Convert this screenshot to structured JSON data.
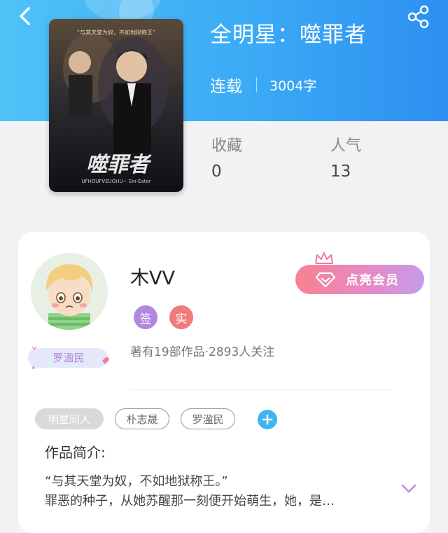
{
  "book": {
    "title": "全明星：噬罪者",
    "status": "连载",
    "word_count": "3004字",
    "cover_title": "噬罪者",
    "cover_tagline": "“与其天堂为奴，不如地狱称王”",
    "cover_subtitle": "UFHOUFVEUGHU~ Sin-Eater"
  },
  "stats": {
    "favorites_label": "收藏",
    "favorites_value": "0",
    "popularity_label": "人气",
    "popularity_value": "13"
  },
  "author": {
    "name": "木VV",
    "badge_sign": "签",
    "badge_real": "实",
    "meta": "著有19部作品·2893人关注",
    "fan_badge": "罗溋民",
    "vip_button": "点亮会员"
  },
  "tags": [
    "明星同人",
    "朴志晟",
    "罗溋民"
  ],
  "intro": {
    "title": "作品简介:",
    "line1": "“与其天堂为奴，不如地狱称王。”",
    "line2": "罪恶的种子，从她苏醒那一刻便开始萌生，她，是…"
  },
  "colors": {
    "header_blue": "#3aa8f5",
    "sign_badge": "#b287e0",
    "real_badge": "#ef7b7b",
    "add_button": "#3fb4f2"
  },
  "icons": {
    "back": "chevron-left-icon",
    "share": "share-icon",
    "vip": "diamond-icon",
    "expand": "chevron-down-icon"
  }
}
